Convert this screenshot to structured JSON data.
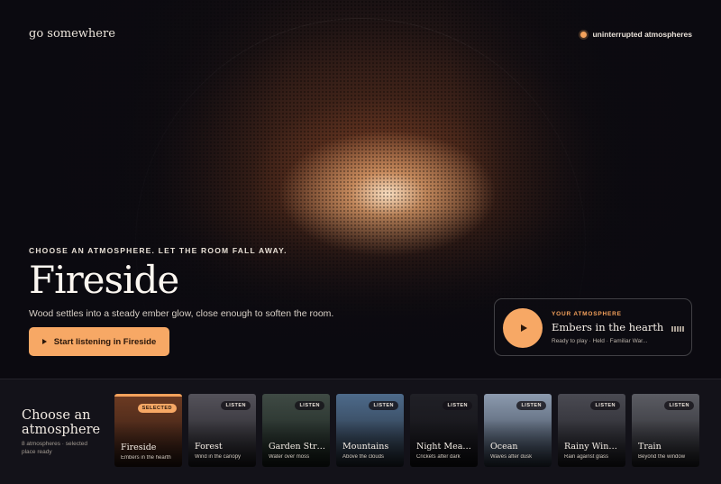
{
  "brand": "go somewhere",
  "status": "uninterrupted atmospheres",
  "hero": {
    "kicker": "CHOOSE AN ATMOSPHERE. LET THE ROOM FALL AWAY.",
    "title": "Fireside",
    "subtitle": "Wood settles into a steady ember glow, close enough to soften the room.",
    "cta_label": "Start listening in Fireside"
  },
  "player": {
    "kicker": "YOUR ATMOSPHERE",
    "title": "Embers in the hearth",
    "meta": "Ready to play · Held · Familiar War..."
  },
  "tray": {
    "title": "Choose an atmosphere",
    "subtitle": "8 atmospheres · selected place ready",
    "cards": [
      {
        "title": "Fireside",
        "subtitle": "Embers in the hearth",
        "badge": "SELECTED",
        "colors": [
          "#6b3a22",
          "#2a1712"
        ]
      },
      {
        "title": "Forest",
        "subtitle": "Wind in the canopy",
        "badge": "LISTEN",
        "colors": [
          "#54525a",
          "#1e1d22"
        ]
      },
      {
        "title": "Garden Streams",
        "subtitle": "Water over moss",
        "badge": "LISTEN",
        "colors": [
          "#3f4a44",
          "#16201b"
        ]
      },
      {
        "title": "Mountains",
        "subtitle": "Above the clouds",
        "badge": "LISTEN",
        "colors": [
          "#4d6a8a",
          "#232b36"
        ]
      },
      {
        "title": "Night Meadow",
        "subtitle": "Crickets after dark",
        "badge": "LISTEN",
        "colors": [
          "#202026",
          "#121116"
        ]
      },
      {
        "title": "Ocean",
        "subtitle": "Waves after dusk",
        "badge": "LISTEN",
        "colors": [
          "#8c9aae",
          "#2f3a4a"
        ]
      },
      {
        "title": "Rainy Window",
        "subtitle": "Rain against glass",
        "badge": "LISTEN",
        "colors": [
          "#4a4a52",
          "#1d1d23"
        ]
      },
      {
        "title": "Train",
        "subtitle": "Beyond the window",
        "badge": "LISTEN",
        "colors": [
          "#5b5c63",
          "#222227"
        ]
      }
    ]
  }
}
